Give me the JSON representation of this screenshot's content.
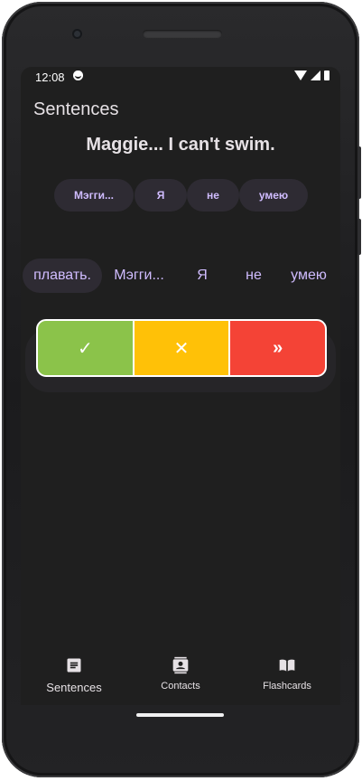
{
  "status_bar": {
    "time": "12:08"
  },
  "app": {
    "title": "Sentences"
  },
  "card": {
    "sentence": "Maggie... I can't swim.",
    "selected_words": [
      "Мэгги...",
      "Я",
      "не",
      "умею"
    ],
    "word_options": [
      "плавать.",
      "Мэгги...",
      "Я",
      "не",
      "умею"
    ],
    "selected_option_index": 0
  },
  "actions": [
    {
      "icon": "check-icon",
      "symbol": "✓",
      "color": "#8bc34a"
    },
    {
      "icon": "close-icon",
      "symbol": "✕",
      "color": "#ffc107"
    },
    {
      "icon": "skip-icon",
      "symbol": "»",
      "color": "#f44336"
    }
  ],
  "bottom_nav": {
    "items": [
      {
        "label": "Sentences",
        "icon": "article-icon",
        "active": true
      },
      {
        "label": "Contacts",
        "icon": "contact-card-icon",
        "active": false
      },
      {
        "label": "Flashcards",
        "icon": "book-icon",
        "active": false
      }
    ]
  }
}
